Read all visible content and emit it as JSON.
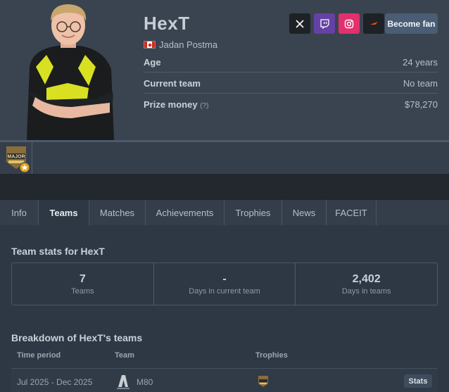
{
  "player": {
    "nickname": "HexT",
    "real_name": "Jadan Postma",
    "country_flag": "canada-flag-icon",
    "age_label": "Age",
    "age_value": "24 years",
    "team_label": "Current team",
    "team_value": "No team",
    "prize_label": "Prize money",
    "prize_hint": "(?)",
    "prize_value": "$78,270"
  },
  "social": {
    "icons": [
      "x-icon",
      "twitch-icon",
      "instagram-icon",
      "faceit-icon"
    ],
    "colors": {
      "twitch": "#6441a5",
      "instagram": "#e1306c",
      "faceit": "#ff5500",
      "x": "#1e2227"
    },
    "become_fan_label": "Become fan"
  },
  "achievements_strip": {
    "items": [
      "major-trophy-icon"
    ],
    "badge_text": "MAJOR"
  },
  "tabs": [
    "Info",
    "Teams",
    "Matches",
    "Achievements",
    "Trophies",
    "News",
    "FACEIT"
  ],
  "active_tab": "Teams",
  "team_stats": {
    "title": "Team stats for HexT",
    "items": [
      {
        "value": "7",
        "caption": "Teams"
      },
      {
        "value": "-",
        "caption": "Days in current team"
      },
      {
        "value": "2,402",
        "caption": "Days in teams"
      }
    ]
  },
  "breakdown": {
    "title": "Breakdown of HexT's teams",
    "columns": [
      "Time period",
      "Team",
      "Trophies"
    ],
    "rows": [
      {
        "period": "Jul 2025 - Dec 2025",
        "team": "M80",
        "trophy_icon": "major-trophy-icon",
        "button": "Stats"
      }
    ]
  }
}
